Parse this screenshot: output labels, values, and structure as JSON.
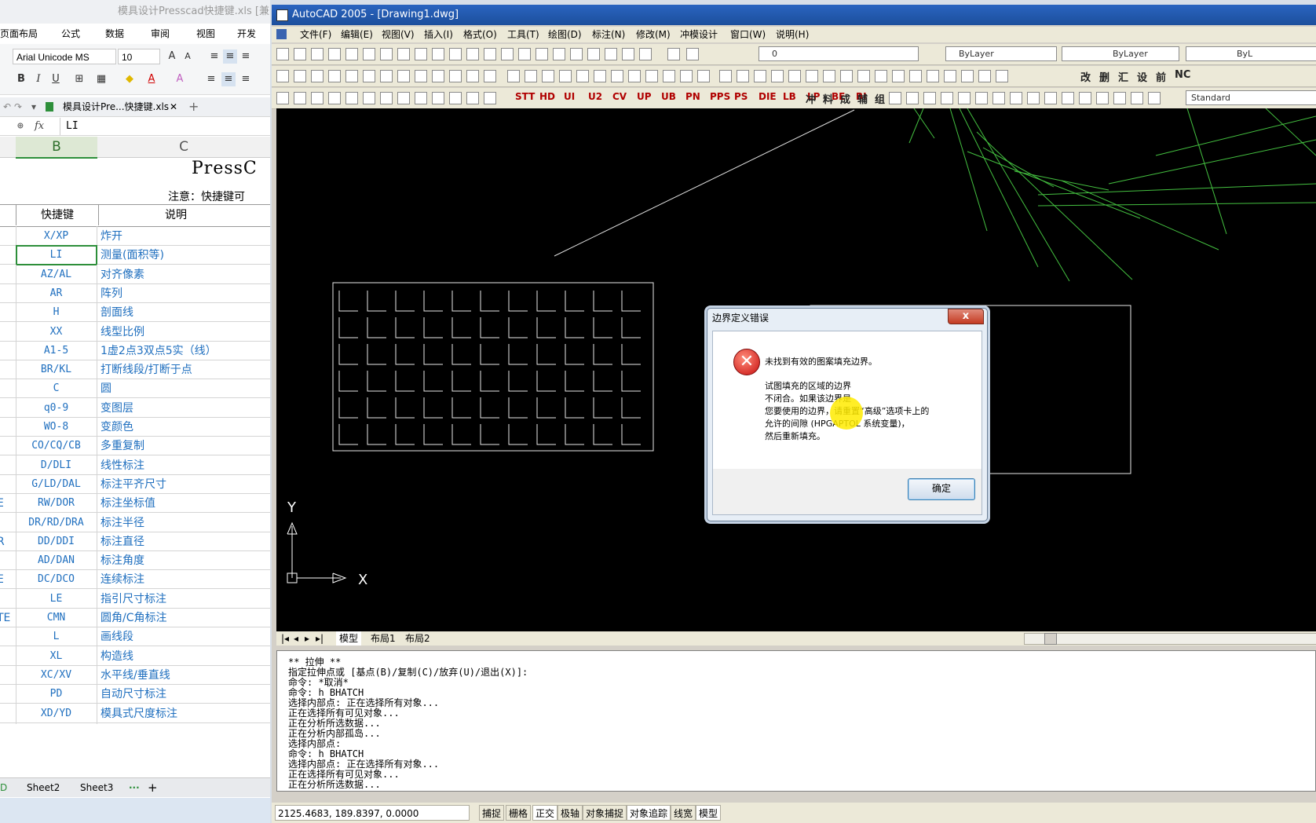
{
  "excel": {
    "window_title": "模具设计Presscad快捷键.xls [兼",
    "ribbon_tabs": [
      "页面布局",
      "公式",
      "数据",
      "审阅",
      "视图",
      "开发"
    ],
    "font_name": "Arial Unicode MS",
    "font_size": "10",
    "file_tab": "模具设计Pre...快捷键.xls",
    "formula_value": "LI",
    "col_b": "B",
    "col_c": "C",
    "sheet_title": "PressC",
    "note": "注意：快捷键可",
    "header_key": "快捷键",
    "header_desc": "说明",
    "rows": [
      {
        "a": "",
        "key": "X/XP",
        "desc": "炸开"
      },
      {
        "a": "",
        "key": "LI",
        "desc": "测量(面积等)"
      },
      {
        "a": "",
        "key": "AZ/AL",
        "desc": "对齐像素"
      },
      {
        "a": "",
        "key": "AR",
        "desc": "阵列"
      },
      {
        "a": "",
        "key": "H",
        "desc": "剖面线"
      },
      {
        "a": "",
        "key": "XX",
        "desc": "线型比例"
      },
      {
        "a": "",
        "key": "A1-5",
        "desc": "1虚2点3双点5实（线）"
      },
      {
        "a": "",
        "key": "BR/KL",
        "desc": "打断线段/打断于点"
      },
      {
        "a": "",
        "key": "C",
        "desc": "圆"
      },
      {
        "a": "",
        "key": "q0-9",
        "desc": "变图层"
      },
      {
        "a": "",
        "key": "WO-8",
        "desc": "变颜色"
      },
      {
        "a": "",
        "key": "CO/CQ/CB",
        "desc": "多重复制"
      },
      {
        "a": "",
        "key": "D/DLI",
        "desc": "线性标注"
      },
      {
        "a": "",
        "key": "G/LD/DAL",
        "desc": "标注平齐尺寸"
      },
      {
        "a": "E",
        "key": "RW/DOR",
        "desc": "标注坐标值"
      },
      {
        "a": "",
        "key": "DR/RD/DRA",
        "desc": "标注半径"
      },
      {
        "a": "R",
        "key": "DD/DDI",
        "desc": "标注直径"
      },
      {
        "a": "",
        "key": "AD/DAN",
        "desc": "标注角度"
      },
      {
        "a": "E",
        "key": "DC/DCO",
        "desc": "连续标注"
      },
      {
        "a": "",
        "key": "LE",
        "desc": "指引尺寸标注"
      },
      {
        "a": "TE",
        "key": "CMN",
        "desc": "圆角/C角标注"
      },
      {
        "a": "",
        "key": "L",
        "desc": "画线段"
      },
      {
        "a": "",
        "key": "XL",
        "desc": "构造线"
      },
      {
        "a": "",
        "key": "XC/XV",
        "desc": "水平线/垂直线"
      },
      {
        "a": "",
        "key": "PD",
        "desc": "自动尺寸标注"
      },
      {
        "a": "",
        "key": "XD/YD",
        "desc": "模具式尺度标注"
      }
    ],
    "sheet_tabs": [
      "Sheet2",
      "Sheet3"
    ],
    "sheet_tab_partial": "D"
  },
  "acad": {
    "window_title": "AutoCAD 2005 - [Drawing1.dwg]",
    "menu": [
      "文件(F)",
      "编辑(E)",
      "视图(V)",
      "插入(I)",
      "格式(O)",
      "工具(T)",
      "绘图(D)",
      "标注(N)",
      "修改(M)",
      "冲模设计",
      "窗口(W)",
      "说明(H)"
    ],
    "layer_value": "0",
    "color_value": "ByLayer",
    "linetype_value": "ByLayer",
    "lineweight_value": "ByL",
    "textstyle_value": "Standard",
    "toolbar_text_a": [
      "STT",
      "HD",
      "UI",
      "U2",
      "CV",
      "UP",
      "UB",
      "PN",
      "PPS",
      "PS",
      "DIE",
      "LB",
      "LP",
      "BE",
      "BI"
    ],
    "toolbar_text_b": [
      "改",
      "删",
      "汇",
      "设",
      "前",
      "NC"
    ],
    "toolbar_text_c": [
      "冲",
      "料",
      "成",
      "辅",
      "组"
    ],
    "axis_y": "Y",
    "axis_x": "X",
    "layout_tabs": [
      "模型",
      "布局1",
      "布局2"
    ],
    "command_lines": [
      "** 拉伸 **",
      "指定拉伸点或 [基点(B)/复制(C)/放弃(U)/退出(X)]:",
      "命令: *取消*",
      "命令: h BHATCH",
      "选择内部点: 正在选择所有对象...",
      "正在选择所有可见对象...",
      "正在分析所选数据...",
      "正在分析内部孤岛...",
      "选择内部点:",
      "命令: h BHATCH",
      "选择内部点: 正在选择所有对象...",
      "正在选择所有可见对象...",
      "正在分析所选数据..."
    ],
    "coords": "2125.4683, 189.8397, 0.0000",
    "status_buttons": [
      "捕捉",
      "栅格",
      "正交",
      "极轴",
      "对象捕捉",
      "对象追踪",
      "线宽",
      "模型"
    ]
  },
  "dialog": {
    "title": "边界定义错误",
    "close": "x",
    "icon": "error-icon",
    "main_message": "未找到有效的图案填充边界。",
    "detail_lines": [
      "试图填充的区域的边界",
      "不闭合。如果该边界是",
      "您要使用的边界，请重置“高级”选项卡上的",
      "允许的间隙 (HPGAPTOL 系统变量)，",
      "然后重新填充。"
    ],
    "ok": "确定"
  },
  "colors": {
    "canvas": "#000000",
    "green_lines": "#44c040",
    "acad_title": "#1c4f9c",
    "excel_text": "#1f6fbf"
  }
}
